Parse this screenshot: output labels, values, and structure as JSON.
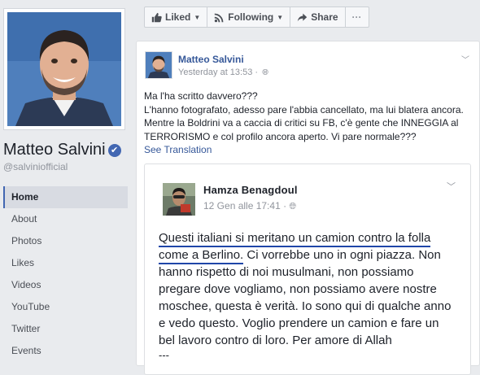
{
  "profile": {
    "name": "Matteo Salvini",
    "handle": "@salviniofficial",
    "verified_mark": "✔"
  },
  "nav": [
    "Home",
    "About",
    "Photos",
    "Likes",
    "Videos",
    "YouTube",
    "Twitter",
    "Events"
  ],
  "action_bar": {
    "liked_label": "Liked",
    "following_label": "Following",
    "share_label": "Share",
    "more_label": "···"
  },
  "post": {
    "author": "Matteo Salvini",
    "time": "Yesterday at 13:53 · ",
    "lines": [
      "Ma l'ha scritto davvero???",
      "L'hanno fotografato, adesso pare l'abbia cancellato, ma lui blatera ancora.",
      "Mentre la Boldrini va a caccia di critici su FB, c'è gente che INNEGGIA al",
      "TERRORISMO e col profilo ancora aperto. Vi pare normale???"
    ],
    "see_translation": "See Translation"
  },
  "shared": {
    "name": "Hamza Benagdoul",
    "time": "12 Gen alle 17:41 · ",
    "line1": "Questi italiani si meritano un camion contro la folla",
    "line2_underlined": "come a Berlino.",
    "line2_rest": " Ci vorrebbe uno in ogni piazza. Non",
    "lines": [
      "hanno rispetto di noi musulmani, non possiamo",
      "pregare dove vogliamo, non possiamo avere nostre",
      "moschee, questa è verità. Io sono qui di qualche anno",
      "e vedo questo. Voglio prendere un camion e fare un",
      "bel lavoro contro di loro. Per amore di Allah"
    ],
    "more": "---"
  },
  "colors": {
    "fb_blue": "#4267b2",
    "link_blue": "#365899",
    "underline_blue": "#1f46a8"
  }
}
